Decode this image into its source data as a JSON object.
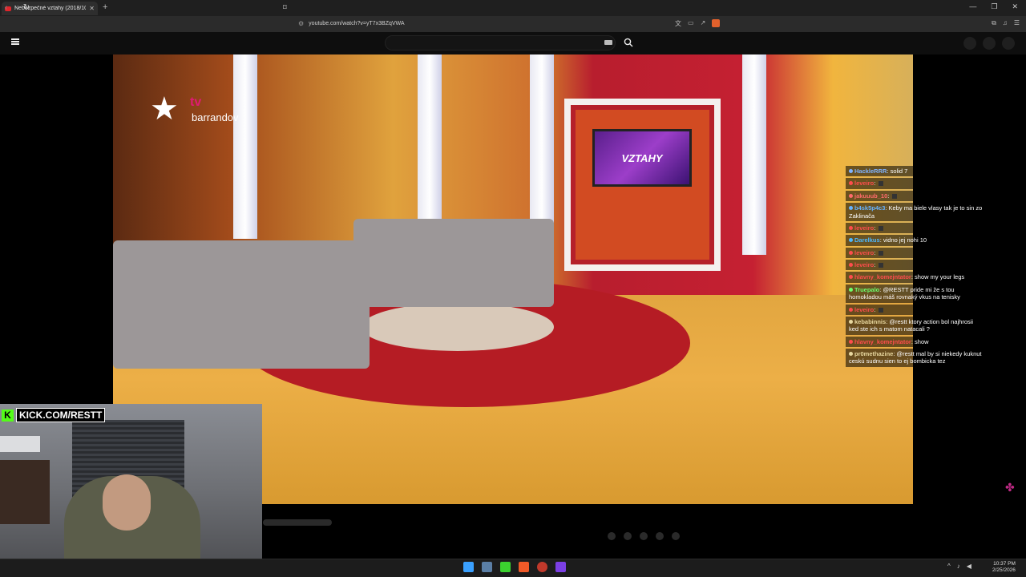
{
  "browser": {
    "tab_title": "Nebezpečné vztahy (2018/10...",
    "tab_close": "✕",
    "new_tab": "+",
    "url": "youtube.com/watch?v=yT7x3BZqVWA",
    "window_controls": [
      "—",
      "❐",
      "✕"
    ]
  },
  "video": {
    "channel_logo_text": "barrandov",
    "channel_logo_tv": "tv",
    "screen_text": "VZTAHY"
  },
  "overlay": {
    "kick_url": "KICK.COM/RESTT"
  },
  "chat": [
    {
      "user": "HackleRRR",
      "text": "solid 7",
      "user_color": "#7fb3ff"
    },
    {
      "user": "leveiro",
      "text": "",
      "user_color": "#ff4d4d",
      "emote": true
    },
    {
      "user": "jakuuub_10",
      "text": "",
      "user_color": "#ff6b6b",
      "emote": true
    },
    {
      "user": "b4sk5p4c3",
      "text": "Keby ma biele vlasy tak je to sin zo Zaklinača",
      "user_color": "#66b3ff"
    },
    {
      "user": "leveiro",
      "text": "",
      "user_color": "#ff4d4d",
      "emote": true
    },
    {
      "user": "Darelkus",
      "text": "vidno jej nohi 10",
      "user_color": "#4db8ff"
    },
    {
      "user": "leveiro",
      "text": "",
      "user_color": "#ff4d4d",
      "emote": true
    },
    {
      "user": "leveiro",
      "text": "",
      "user_color": "#ff4d4d",
      "emote": true
    },
    {
      "user": "hlavny_komejntator",
      "text": "show my your legs",
      "user_color": "#ff4d4d"
    },
    {
      "user": "Truepalo",
      "text": "@RESTT pride mi že s tou homokladou máš rovnaký vkus na tenisky",
      "user_color": "#6dff6d"
    },
    {
      "user": "leveiro",
      "text": "",
      "user_color": "#ff4d4d",
      "emote": true
    },
    {
      "user": "kebabinnis",
      "text": "@restt ktory action bol najhrosii ked ste ich s matom natacali ?",
      "user_color": "#e8d8a0"
    },
    {
      "user": "hlavny_komejntator",
      "text": "show",
      "user_color": "#ff4d4d"
    },
    {
      "user": "pr0methazine",
      "text": "@restt mal by si niekedy kuknut ceskú sudnu sien to ej bombicka tez",
      "user_color": "#e8d8a0"
    }
  ],
  "taskbar": {
    "time": "10:37 PM",
    "date": "2/25/2026"
  }
}
